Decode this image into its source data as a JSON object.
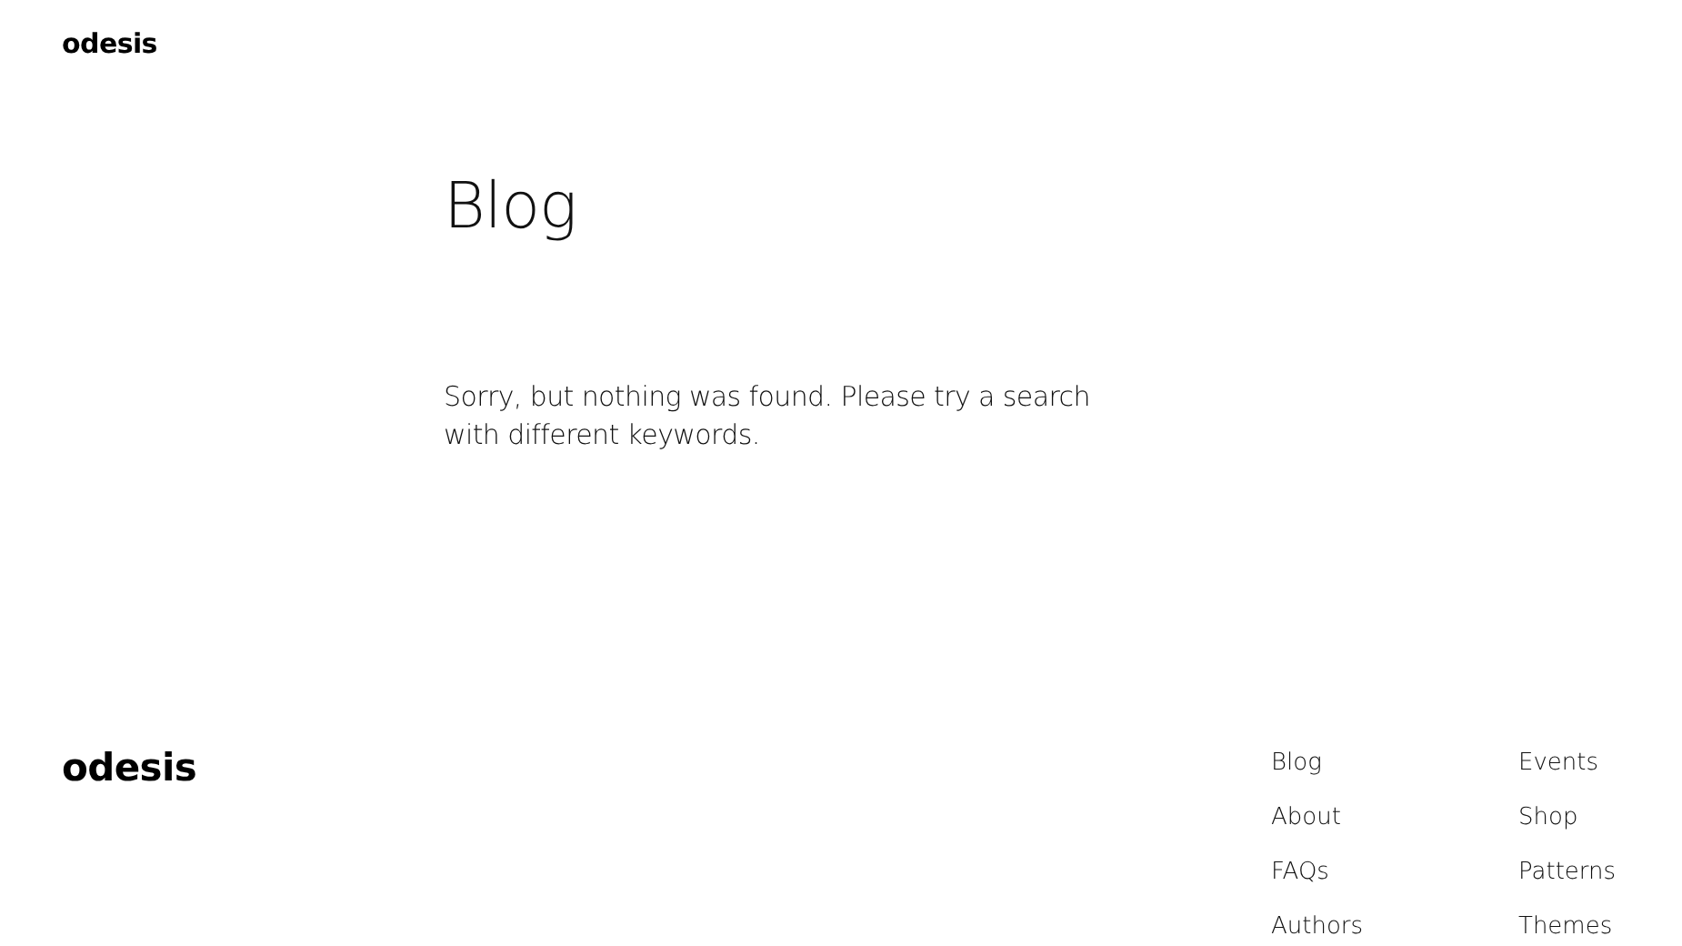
{
  "header": {
    "site_title": "odesis"
  },
  "main": {
    "title": "Blog",
    "message": "Sorry, but nothing was found. Please try a search with different keywords."
  },
  "footer": {
    "site_title": "odesis",
    "nav_columns": [
      [
        "Blog",
        "About",
        "FAQs",
        "Authors"
      ],
      [
        "Events",
        "Shop",
        "Patterns",
        "Themes"
      ]
    ]
  }
}
